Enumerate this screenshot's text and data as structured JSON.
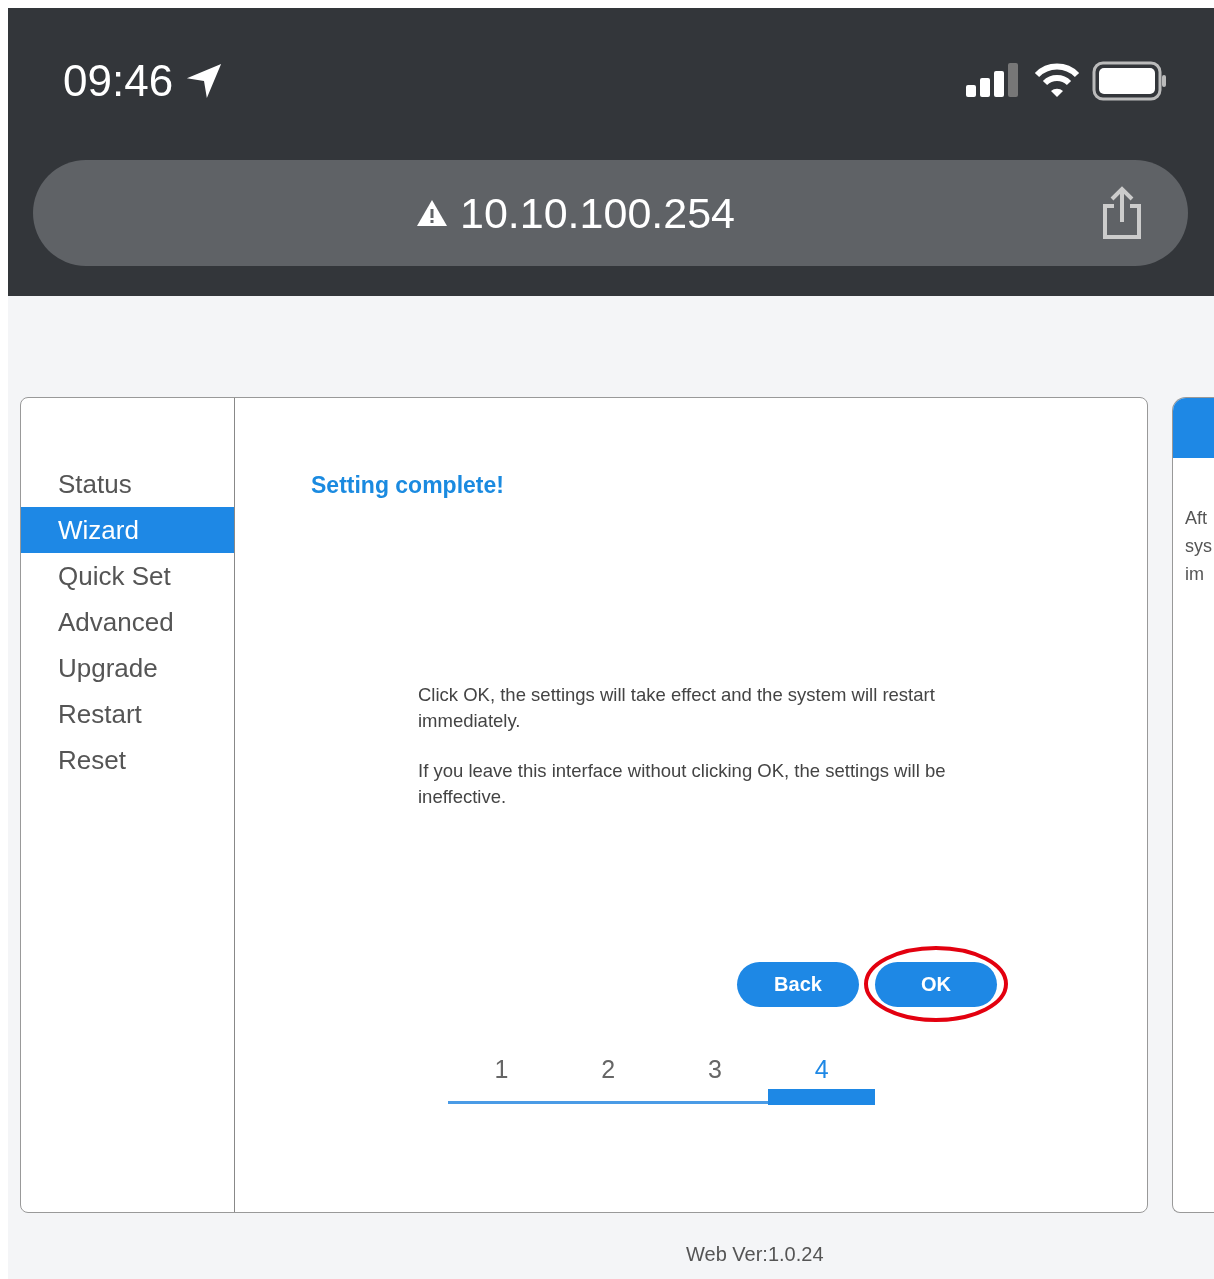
{
  "status_bar": {
    "time": "09:46"
  },
  "address_bar": {
    "url": "10.10.100.254"
  },
  "sidebar": {
    "items": [
      {
        "label": "Status",
        "selected": false
      },
      {
        "label": "Wizard",
        "selected": true
      },
      {
        "label": "Quick Set",
        "selected": false
      },
      {
        "label": "Advanced",
        "selected": false
      },
      {
        "label": "Upgrade",
        "selected": false
      },
      {
        "label": "Restart",
        "selected": false
      },
      {
        "label": "Reset",
        "selected": false
      }
    ]
  },
  "panel": {
    "title": "Setting complete!",
    "paragraphs": [
      "Click OK, the settings will take effect and the system will restart immediately.",
      "If you leave this interface without clicking OK, the settings will be ineffective."
    ],
    "buttons": [
      {
        "label": "Back",
        "circled": false
      },
      {
        "label": "OK",
        "circled": true
      }
    ],
    "steps": [
      {
        "label": "1",
        "selected": false
      },
      {
        "label": "2",
        "selected": false
      },
      {
        "label": "3",
        "selected": false
      },
      {
        "label": "4",
        "selected": true
      }
    ]
  },
  "side_panel": {
    "lines": [
      "Aft",
      "sys",
      "im"
    ]
  },
  "footer": {
    "version": "Web Ver:1.0.24"
  }
}
